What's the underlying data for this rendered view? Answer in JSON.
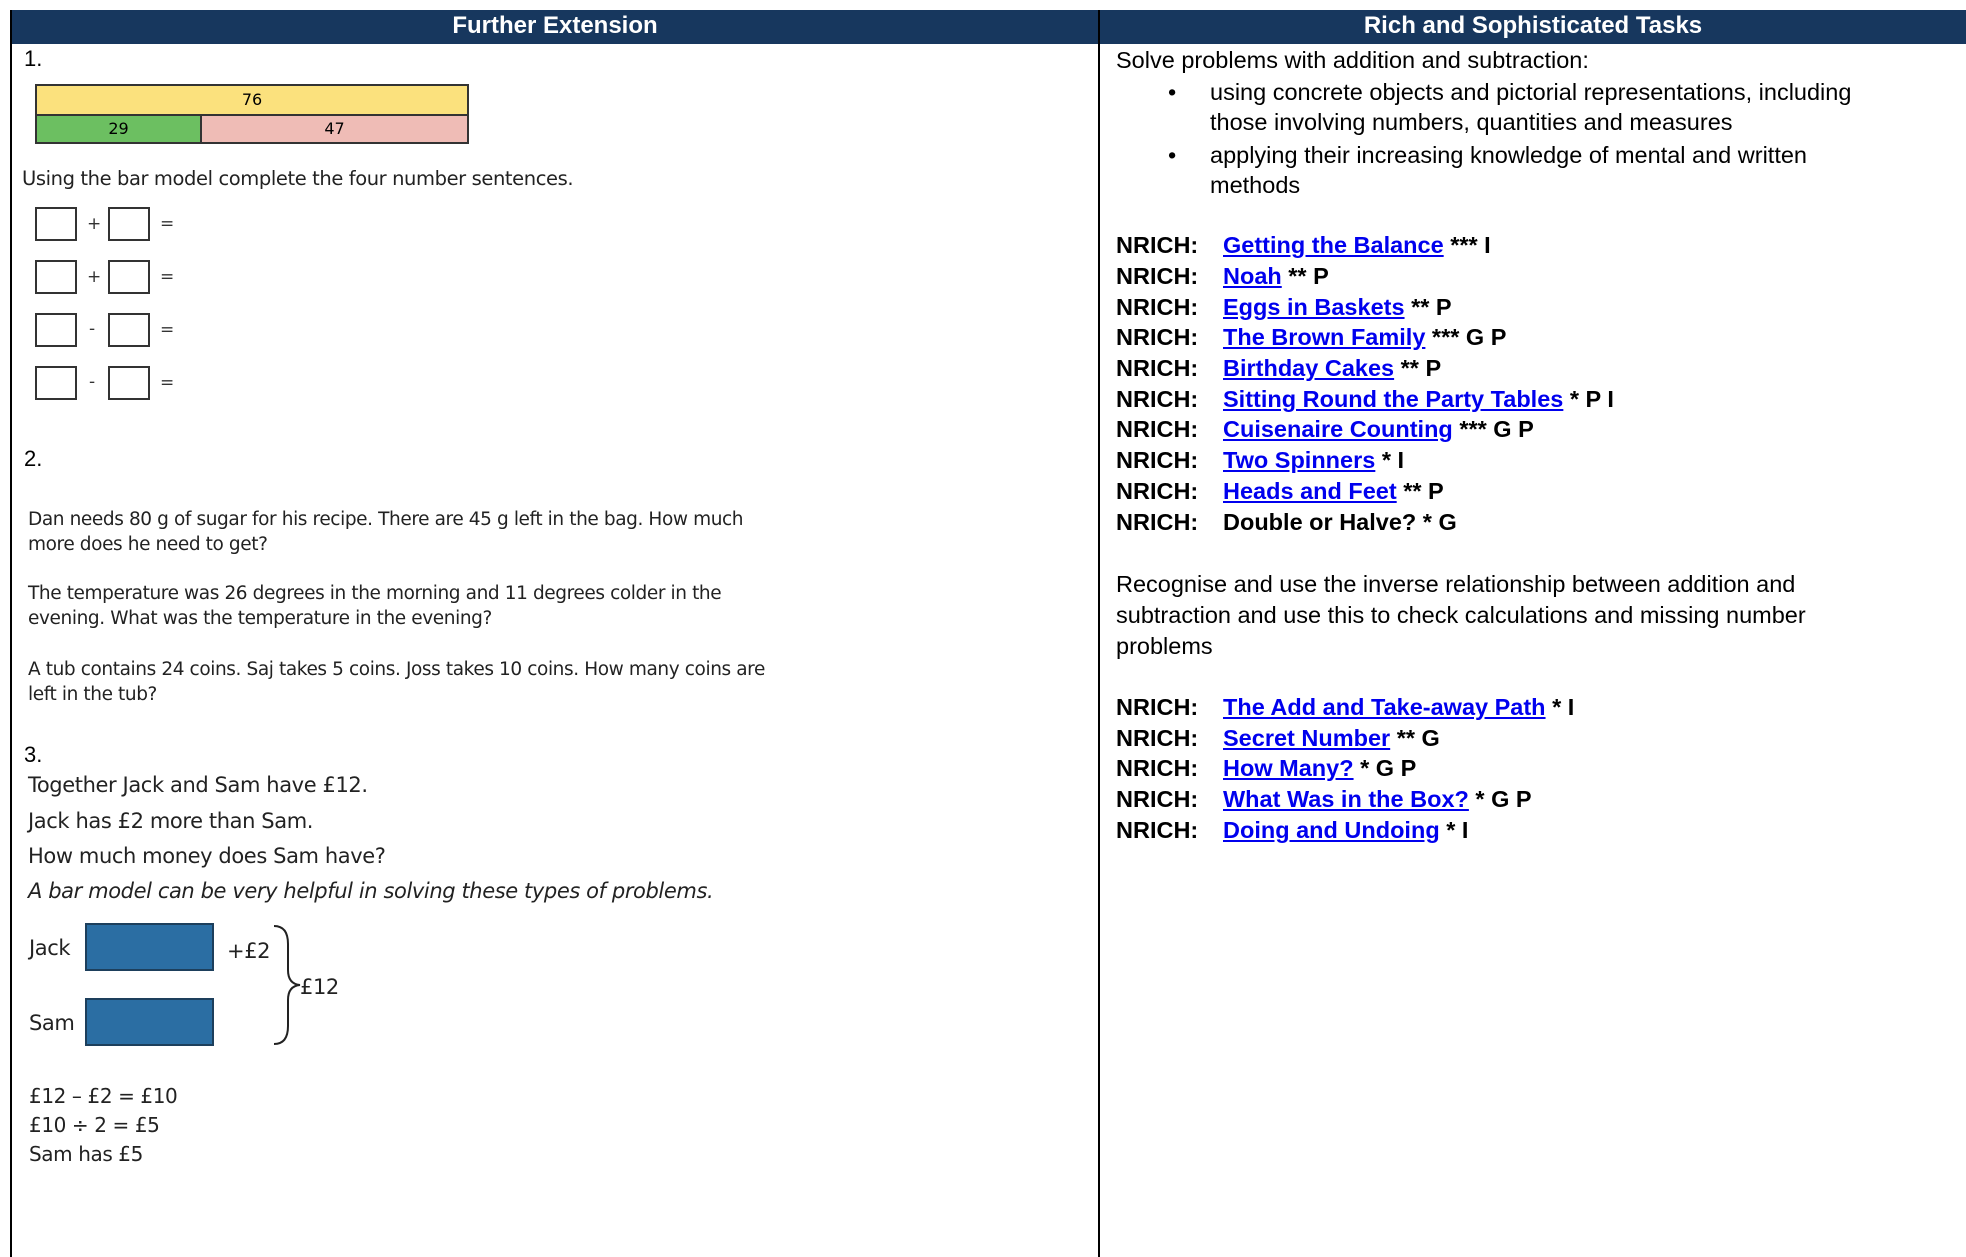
{
  "headers": {
    "left": "Further Extension",
    "right": "Rich and Sophisticated Tasks"
  },
  "left": {
    "q1_num": "1.",
    "bar_top": "76",
    "bar_left": "29",
    "bar_right": "47",
    "q1_text": "Using the bar model complete the four number sentences.",
    "plus": "+",
    "minus": "-",
    "equals": "=",
    "q2_num": "2.",
    "q2_p1_l1": "Dan needs 80 g of sugar for his recipe. There are 45 g left in the bag. How much",
    "q2_p1_l2": "more does he need to get?",
    "q2_p2_l1": "The temperature was 26 degrees in the morning and 11 degrees colder in the",
    "q2_p2_l2": "evening. What was the temperature in the evening?",
    "q2_p3_l1": "A tub contains 24 coins. Saj takes 5 coins. Joss takes 10 coins. How many coins are",
    "q2_p3_l2": "left in the tub?",
    "q3_num": "3.",
    "q3_l1": "Together Jack and Sam have £12.",
    "q3_l2": "Jack has £2 more than Sam.",
    "q3_l3": "How much money does Sam have?",
    "q3_l4": "A bar model can be very helpful in solving these types of problems.",
    "jack": "Jack",
    "sam": "Sam",
    "plus2": "+£2",
    "total": "£12",
    "sol1": "£12 – £2 = £10",
    "sol2": "£10 ÷ 2 = £5",
    "sol3": "Sam has £5"
  },
  "right": {
    "intro1": "Solve problems with addition and subtraction:",
    "bullet1_l1": "using concrete objects and pictorial representations, including",
    "bullet1_l2": "those involving numbers, quantities and measures",
    "bullet2_l1": "applying their increasing knowledge of mental and written",
    "bullet2_l2": "methods",
    "bullet_char": "•",
    "nrich_label": "NRICH:",
    "group1": [
      {
        "link": "Getting the Balance",
        "tags": " *** I"
      },
      {
        "link": "Noah",
        "tags": " ** P"
      },
      {
        "link": "Eggs in Baskets",
        "tags": " ** P"
      },
      {
        "link": "The Brown Family",
        "tags": " *** G P"
      },
      {
        "link": "Birthday Cakes",
        "tags": " ** P"
      },
      {
        "link": "Sitting Round the Party Tables",
        "tags": " * P I"
      },
      {
        "link": "Cuisenaire Counting",
        "tags": " *** G P"
      },
      {
        "link": "Two Spinners",
        "tags": " * I"
      },
      {
        "link": "Heads and Feet",
        "tags": " ** P"
      }
    ],
    "plain_item": "Double or Halve? * G",
    "intro2_l1": "Recognise and use the inverse relationship between addition and",
    "intro2_l2": "subtraction and use this to check calculations and missing number",
    "intro2_l3": "problems",
    "group2": [
      {
        "link": "The Add and Take-away Path",
        "tags": " * I"
      },
      {
        "link": "Secret Number",
        "tags": " ** G"
      },
      {
        "link": "How Many?",
        "tags": " * G P"
      },
      {
        "link": "What Was in the Box?",
        "tags": " * G P"
      },
      {
        "link": "Doing and Undoing",
        "tags": " * I"
      }
    ]
  }
}
